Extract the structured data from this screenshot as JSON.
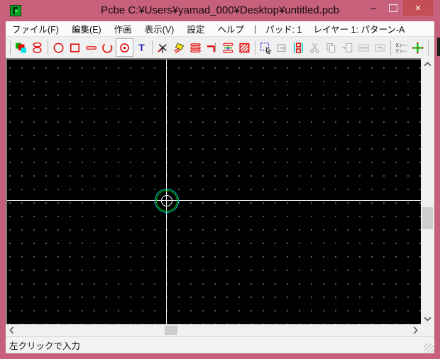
{
  "window": {
    "title": "Pcbe C:¥Users¥yamad_000¥Desktop¥untitled.pcb",
    "controls": {
      "minimize_glyph": "–",
      "close_glyph": "×"
    },
    "theme": {
      "titlebar": "#c6607b",
      "close_button": "#c44e56"
    }
  },
  "menu": {
    "items": [
      {
        "label": "ファイル(F)"
      },
      {
        "label": "編集(E)"
      },
      {
        "label": "作画"
      },
      {
        "label": "表示(V)"
      },
      {
        "label": "設定"
      },
      {
        "label": "ヘルプ"
      }
    ],
    "divider": "|",
    "pad_indicator": "パッド: 1",
    "layer_indicator": "レイヤー 1: パターン-A"
  },
  "toolbar": {
    "items": [
      "layers-tool",
      "pad-stack-tool",
      "draw-circle-tool",
      "draw-rectangle-tool",
      "draw-line-tool",
      "draw-arc-tool",
      "draw-pad-tool",
      "draw-text-tool",
      "break-line-tool",
      "eraser-tool",
      "multi-line-tool",
      "line-end-tool",
      "via-tool",
      "hatch-fill-tool",
      "select-tool",
      "move-tool",
      "flip-layer-tool",
      "cut-tool",
      "copy-tool",
      "paste-tool",
      "stretch-tool",
      "undo-tool",
      "xy-coordinate-tool",
      "origin-grid-tool"
    ],
    "selected": "draw-pad-tool",
    "text_tool_glyph": "T"
  },
  "canvas": {
    "background": "#000000",
    "dot_color": "#a8a8a8",
    "crosshair_color": "#ffffff",
    "pad_preview": {
      "outer_ring": "#00dcdc",
      "inner_ring": "#00c800",
      "center_circle": "#ffffff"
    }
  },
  "statusbar": {
    "message": "左クリックで入力"
  }
}
